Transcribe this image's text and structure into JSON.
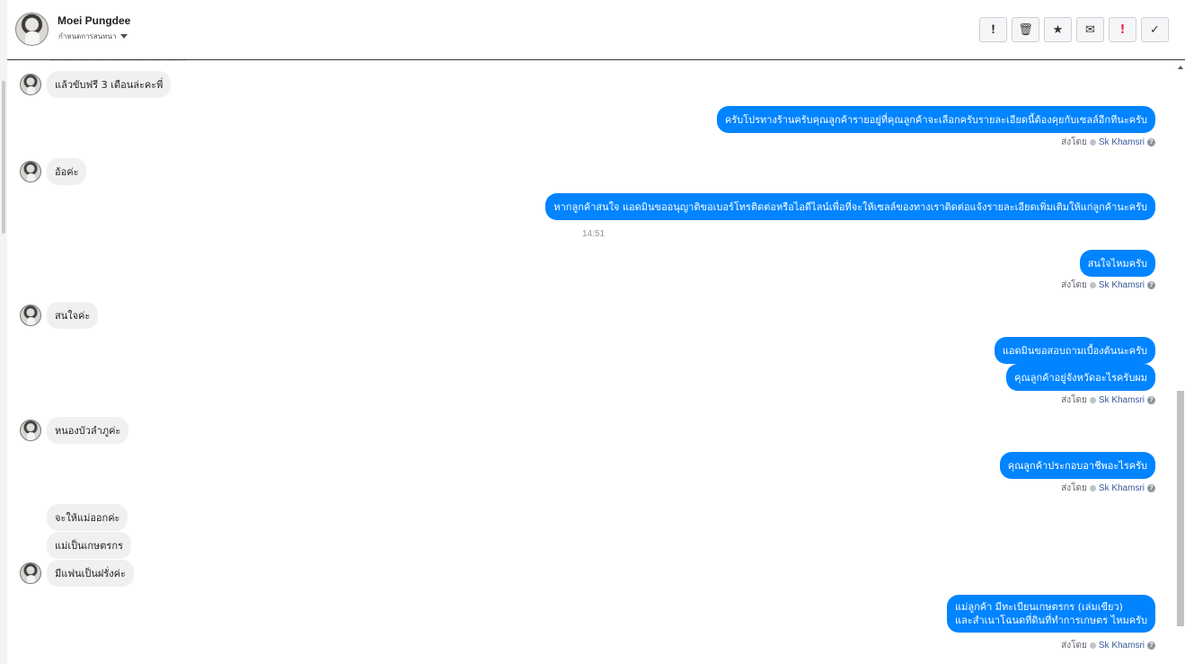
{
  "header": {
    "contact_name": "Moei Pungdee",
    "subtitle": "กำหนดการสนทนา",
    "actions": [
      "mark-spam",
      "delete",
      "star",
      "mark-unread",
      "follow-up",
      "done"
    ]
  },
  "sent_by": {
    "prefix": "ส่งโดย",
    "agent": "Sk Khamsri"
  },
  "messages": {
    "in1": "แล้วขับฟรี 3 เดือนล่ะคะพี่",
    "out1": "ครับโปรทางร้านครับคุณลูกค้ารายอยู่ที่คุณลูกค้าจะเลือกครับรายละเอียดนี้ต้องคุยกับเซลล์อีกทีนะครับ",
    "in2": "อ้อค่ะ",
    "out2": "หากลูกค้าสนใจ แอดมินขออนุญาติขอเบอร์โทรติดต่อหรือไอดีไลน์เพื่อที่จะให้เซลล์ของทางเราติดต่อแจ้งรายละเอียดเพิ่มเติมให้แก่ลูกค้านะครับ",
    "time1": "14:51",
    "out3": "สนใจไหมครับ",
    "in3": "สนใจค่ะ",
    "out4": "แอดมินขอสอบถามเบื้องต้นนะครับ",
    "out5": "คุณลูกค้าอยู่จังหวัดอะไรครับผม",
    "in4": "หนองบัวลำภูค่ะ",
    "out6": "คุณลูกค้าประกอบอาชีพอะไรครับ",
    "in5": "จะให้แม่ออกค่ะ",
    "in6": "แม่เป็นเกษตรกร",
    "in7": "มีแฟนเป็นฝรั่งค่ะ",
    "out7_line1": "แม่ลูกค้า มีทะเบียนเกษตรกร (เล่มเขียว)",
    "out7_line2": "และสำเนาโฉนดที่ดินที่ทำการเกษตร ไหมครับ"
  }
}
